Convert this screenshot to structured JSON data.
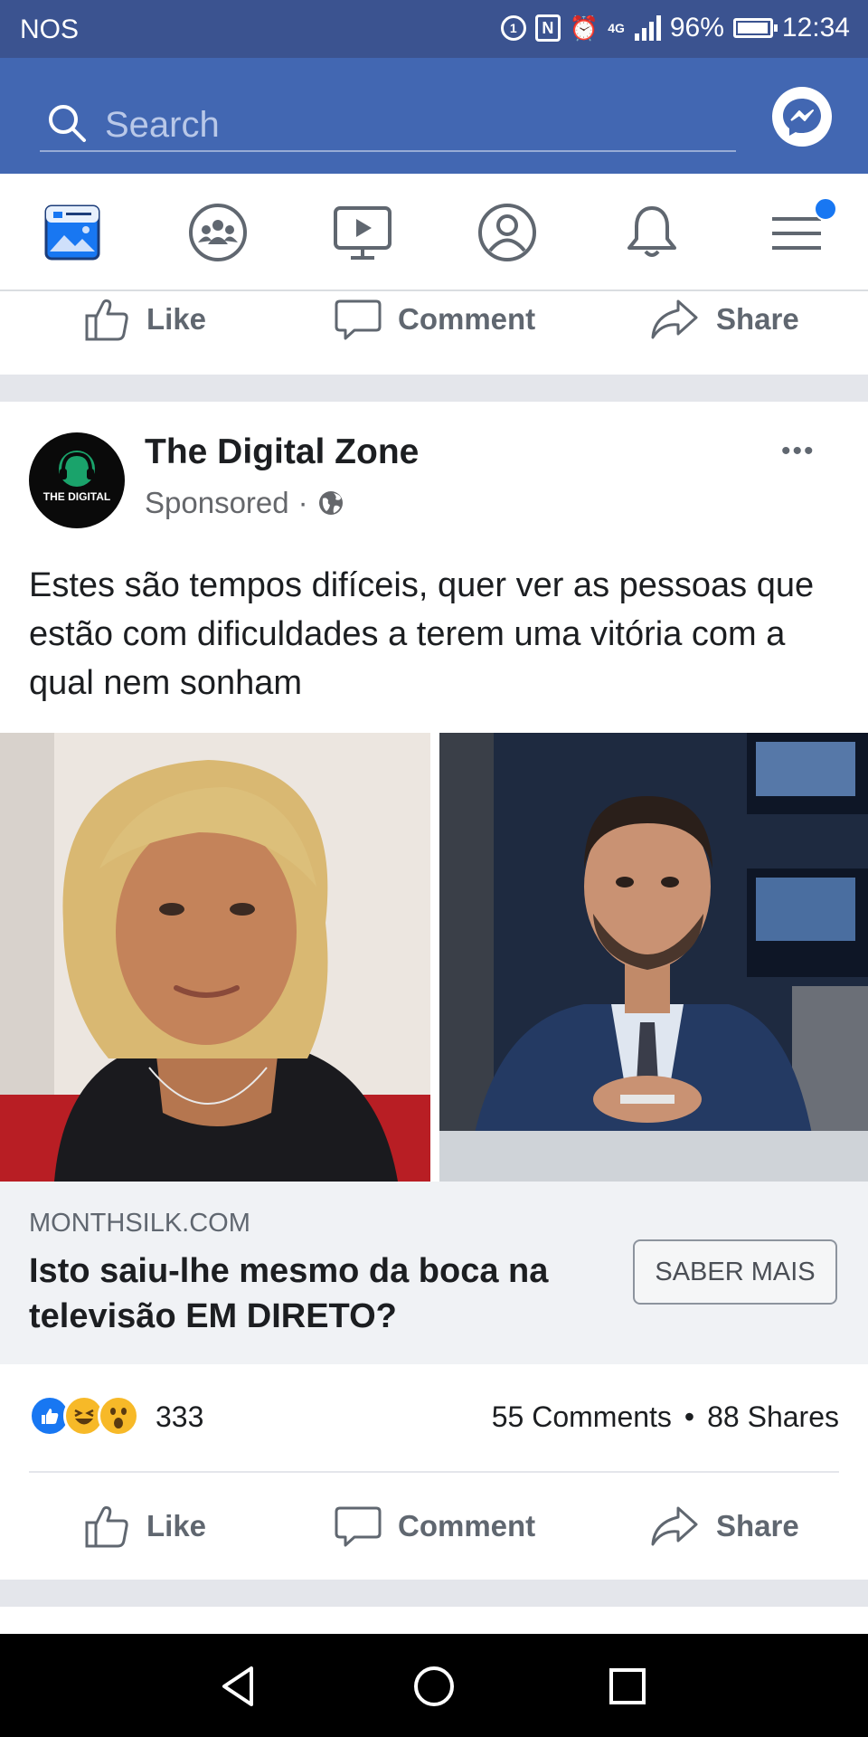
{
  "status_bar": {
    "carrier": "NOS",
    "badge_1": "1",
    "nfc": "N",
    "network": "4G",
    "battery_percent": "96%",
    "battery_level": 0.96,
    "time": "12:34"
  },
  "header": {
    "search_placeholder": "Search"
  },
  "nav_tabs": [
    {
      "name": "news-feed",
      "icon": "newsfeed-icon"
    },
    {
      "name": "groups",
      "icon": "groups-icon"
    },
    {
      "name": "watch",
      "icon": "watch-icon"
    },
    {
      "name": "profile",
      "icon": "profile-icon"
    },
    {
      "name": "notifications",
      "icon": "bell-icon"
    },
    {
      "name": "menu",
      "icon": "menu-icon",
      "has_dot": true
    }
  ],
  "actions": {
    "like": "Like",
    "comment": "Comment",
    "share": "Share"
  },
  "post": {
    "avatar_text": "THE DIGITAL",
    "page_name": "The Digital Zone",
    "sponsored": "Sponsored",
    "separator": "·",
    "more": "•••",
    "text": "Estes são tempos difíceis, quer ver as pessoas que estão com dificuldades a terem uma vitória com a qual nem sonham",
    "link": {
      "domain": "MONTHSILK.COM",
      "title": "Isto saiu-lhe mesmo da boca na televisão EM DIRETO?",
      "cta": "SABER MAIS"
    },
    "reactions_count": "333",
    "comments": "55 Comments",
    "dot": "•",
    "shares": "88 Shares"
  },
  "colors": {
    "status_bar": "#3b5390",
    "header": "#4267b2",
    "accent": "#1877f2",
    "separator": "#e4e6eb"
  }
}
